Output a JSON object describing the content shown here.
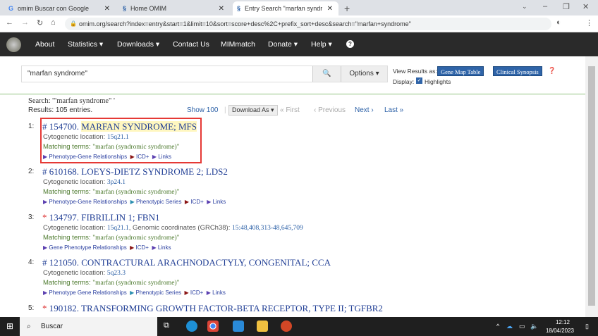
{
  "browser": {
    "tabs": [
      {
        "label": "omim  Buscar con Google",
        "icon": "google-icon"
      },
      {
        "label": "Home  OMIM",
        "icon": "omim-icon"
      },
      {
        "label": "Entry Search  \"marfan syndrome\"",
        "icon": "omim-icon"
      }
    ],
    "url": "omim.org/search?index=entry&start=1&limit=10&sort=score+desc%2C+prefix_sort+desc&search=\"marfan+syndrome\""
  },
  "nav": {
    "items": [
      "About",
      "Statistics ▾",
      "Downloads ▾",
      "Contact Us",
      "MIMmatch",
      "Donate ▾",
      "Help ▾"
    ]
  },
  "search": {
    "value": "\"marfan syndrome\"",
    "options_label": "Options ▾",
    "view_label": "View Results as:",
    "gene_map": "Gene Map Table",
    "clinical": "Clinical Synopsis",
    "display_label": "Display:",
    "highlights": "Highlights",
    "highlights_checked": true
  },
  "results_header": {
    "search": "Search: '\"marfan syndrome\" '",
    "count": "Results: 105 entries.",
    "show100": "Show 100",
    "download": "Download As ▾",
    "first": "« First",
    "previous": "‹ Previous",
    "next": "Next ›",
    "last": "Last »"
  },
  "results": [
    {
      "num": "1:",
      "prefix": "#",
      "id": "154700.",
      "title": "MARFAN SYNDROME; MFS",
      "cyto_label": "Cytogenetic location:",
      "cyto": "15q21.1",
      "match_label": "Matching terms:",
      "match": "\"marfan (syndromic syndrome)\"",
      "links": [
        "Phenotype-Gene Relationships",
        "ICD+",
        "Links"
      ]
    },
    {
      "num": "2:",
      "prefix": "#",
      "id": "610168.",
      "title": "LOEYS-DIETZ SYNDROME 2; LDS2",
      "cyto_label": "Cytogenetic location:",
      "cyto": "3p24.1",
      "match_label": "Matching terms:",
      "match": "\"marfan (syndromic syndrome)\"",
      "links": [
        "Phenotype-Gene Relationships",
        "Phenotypic Series",
        "ICD+",
        "Links"
      ]
    },
    {
      "num": "3:",
      "prefix": "*",
      "id": "134797.",
      "title": "FIBRILLIN 1; FBN1",
      "cyto_label": "Cytogenetic location:",
      "cyto": "15q21.1",
      "genomic_label": ", Genomic coordinates (GRCh38):",
      "genomic": "15:48,408,313-48,645,709",
      "match_label": "Matching terms:",
      "match": "\"marfan (syndromic syndrome)\"",
      "links": [
        "Gene Phenotype Relationships",
        "ICD+",
        "Links"
      ]
    },
    {
      "num": "4:",
      "prefix": "#",
      "id": "121050.",
      "title": "CONTRACTURAL ARACHNODACTYLY, CONGENITAL; CCA",
      "cyto_label": "Cytogenetic location:",
      "cyto": "5q23.3",
      "match_label": "Matching terms:",
      "match": "\"marfan (syndromic syndrome)\"",
      "links": [
        "Phenotype Gene Relationships",
        "Phenotypic Series",
        "ICD+",
        "Links"
      ]
    },
    {
      "num": "5:",
      "prefix": "*",
      "id": "190182.",
      "title": "TRANSFORMING GROWTH FACTOR-BETA RECEPTOR, TYPE II; TGFBR2"
    }
  ],
  "taskbar": {
    "search": "Buscar",
    "time": "12:12",
    "date": "18/04/2023"
  }
}
